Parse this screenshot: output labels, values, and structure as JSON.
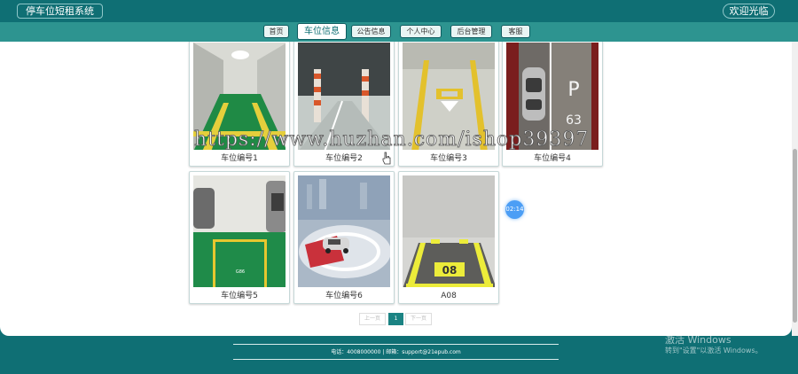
{
  "header": {
    "site_title": "停车位短租系统",
    "welcome": "欢迎光临"
  },
  "nav": {
    "items": [
      "首页",
      "车位信息",
      "公告信息",
      "个人中心",
      "后台管理",
      "客服"
    ],
    "active_index": 1
  },
  "spaces": [
    {
      "label": "车位编号1"
    },
    {
      "label": "车位编号2"
    },
    {
      "label": "车位编号3"
    },
    {
      "label": "车位编号4"
    },
    {
      "label": "车位编号5"
    },
    {
      "label": "车位编号6"
    },
    {
      "label": "A08"
    }
  ],
  "image_text": {
    "p_sign": "P",
    "space_number_4": "63",
    "space_number_a08": "08",
    "slot_text_5": "G86"
  },
  "watermark": "https://www.huzhan.com/ishop39397",
  "timer": "02:14",
  "pagination": {
    "prev": "上一页",
    "current": "1",
    "next": "下一页"
  },
  "footer": {
    "contact": "电话：4008000000 | 邮箱：support@21epub.com"
  },
  "os_overlay": {
    "activate": "激活 Windows",
    "hint": "转到\"设置\"以激活 Windows。"
  },
  "colors": {
    "primary": "#0f6f74",
    "nav_bar": "#2d9490",
    "accent": "#1b8383",
    "timer": "#4c9ef5"
  }
}
